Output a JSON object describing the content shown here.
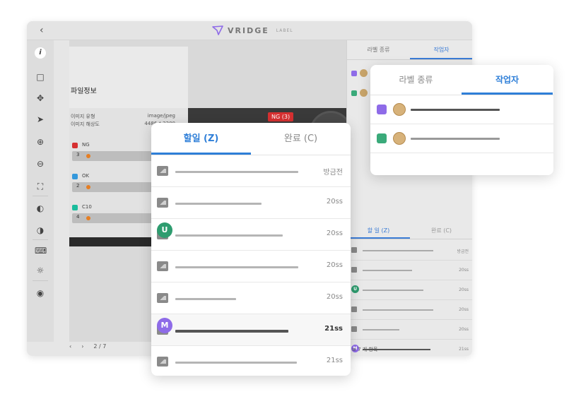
{
  "app": {
    "back_icon": "chevron-left-icon",
    "logo_text": "VRIDGE",
    "logo_sub": "LABEL"
  },
  "toolbar": {
    "tools": [
      "info-icon",
      "rectangle-icon",
      "move-icon",
      "pointer-icon",
      "zoom-in-icon",
      "zoom-out-icon",
      "fit-screen-icon",
      "brightness-icon",
      "contrast-icon",
      "keyboard-icon",
      "idea-icon",
      "robot-icon"
    ]
  },
  "info_panel": {
    "title": "파일정보",
    "rows": [
      {
        "key": "이미지 유형",
        "value": "image/jpeg"
      },
      {
        "key": "이미지 해상도",
        "value": "4486 * 2200"
      }
    ],
    "labels": [
      {
        "name": "NG",
        "count": "3",
        "color": "#d63031"
      },
      {
        "name": "OK",
        "count": "2",
        "color": "#3498db"
      },
      {
        "name": "C10",
        "count": "4",
        "color": "#1abc9c"
      }
    ]
  },
  "canvas": {
    "ng_tag": "NG (3)"
  },
  "pager": {
    "page": "2 / 7"
  },
  "right_col": {
    "tab_labels": "라벨 종류",
    "tab_workers": "작업자",
    "tab_todo": "할 일 (Z)",
    "tab_done": "완료 (C)",
    "rows": [
      {
        "time": "방금전",
        "badge": ""
      },
      {
        "time": "20ss",
        "badge": ""
      },
      {
        "time": "20ss",
        "badge": "U"
      },
      {
        "time": "20ss",
        "badge": ""
      },
      {
        "time": "20ss",
        "badge": ""
      },
      {
        "time": "21ss",
        "badge": "M"
      }
    ],
    "footer": "7 개 항목"
  },
  "task_card": {
    "tab_todo": "할일 (Z)",
    "tab_done": "완료 (C)",
    "rows": [
      {
        "time": "방금전",
        "badge": "",
        "badge_color": "",
        "line_width": 174,
        "selected": false
      },
      {
        "time": "20ss",
        "badge": "",
        "badge_color": "",
        "line_width": 122,
        "selected": false
      },
      {
        "time": "20ss",
        "badge": "U",
        "badge_color": "#2e9c6f",
        "line_width": 152,
        "selected": false
      },
      {
        "time": "20ss",
        "badge": "",
        "badge_color": "",
        "line_width": 174,
        "selected": false
      },
      {
        "time": "20ss",
        "badge": "",
        "badge_color": "",
        "line_width": 86,
        "selected": false
      },
      {
        "time": "21ss",
        "badge": "M",
        "badge_color": "#8e6be8",
        "line_width": 160,
        "selected": true
      },
      {
        "time": "21ss",
        "badge": "",
        "badge_color": "",
        "line_width": 172,
        "selected": false
      }
    ]
  },
  "worker_card": {
    "tab_labels": "라벨 종류",
    "tab_workers": "작업자",
    "workers": [
      {
        "color": "#8e6be8",
        "line_color": "#555555",
        "line_width": 126
      },
      {
        "color": "#3aaa7a",
        "line_color": "#999999",
        "line_width": 126
      }
    ]
  }
}
